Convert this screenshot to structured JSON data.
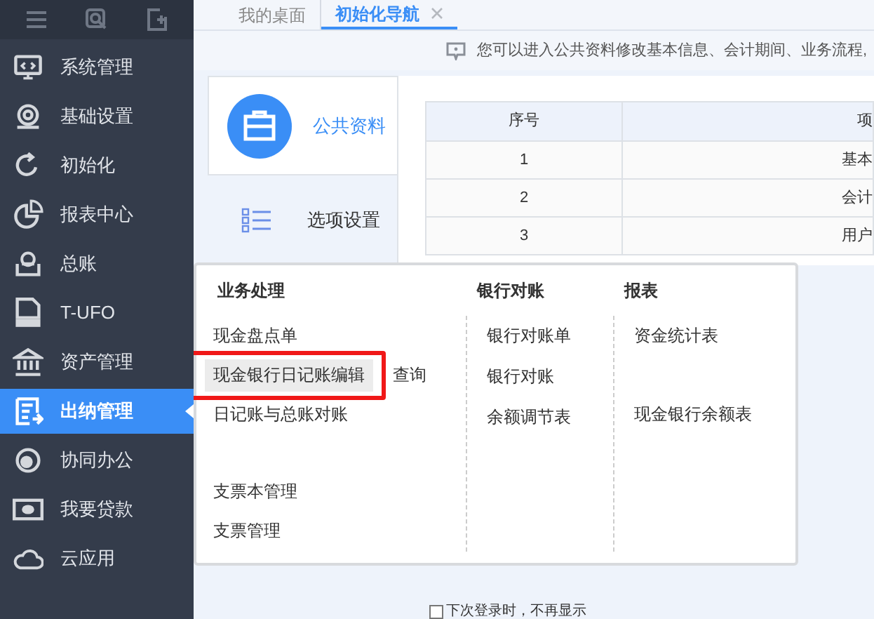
{
  "sidebar": {
    "items": [
      {
        "label": "系统管理",
        "selected": false
      },
      {
        "label": "基础设置",
        "selected": false
      },
      {
        "label": "初始化",
        "selected": false
      },
      {
        "label": "报表中心",
        "selected": false
      },
      {
        "label": "总账",
        "selected": false
      },
      {
        "label": "T-UFO",
        "selected": false
      },
      {
        "label": "资产管理",
        "selected": false
      },
      {
        "label": "出纳管理",
        "selected": true
      },
      {
        "label": "协同办公",
        "selected": false
      },
      {
        "label": "我要贷款",
        "selected": false
      },
      {
        "label": "云应用",
        "selected": false
      }
    ]
  },
  "tabs": [
    {
      "label": "我的桌面",
      "selected": false,
      "closable": false
    },
    {
      "label": "初始化导航",
      "selected": true,
      "closable": true
    }
  ],
  "notice": "您可以进入公共资料修改基本信息、会计期间、业务流程,",
  "nav": [
    {
      "label": "公共资料",
      "selected": true
    },
    {
      "label": "选项设置",
      "selected": false
    }
  ],
  "table": {
    "columns": [
      "序号",
      "项"
    ],
    "rows": [
      [
        "1",
        "基本"
      ],
      [
        "2",
        "会计"
      ],
      [
        "3",
        "用户"
      ]
    ]
  },
  "menu": {
    "columns": [
      {
        "title": "业务处理",
        "groups": [
          [
            {
              "label": "现金盘点单",
              "selected": false,
              "marked": false
            },
            {
              "label": "现金银行日记账编辑",
              "selected": true,
              "marked": true,
              "extra": "查询"
            },
            {
              "label": "日记账与总账对账",
              "selected": false,
              "marked": false
            }
          ],
          [
            {
              "label": "支票本管理",
              "selected": false,
              "marked": false
            },
            {
              "label": "支票管理",
              "selected": false,
              "marked": false
            }
          ]
        ]
      },
      {
        "title": "银行对账",
        "groups": [
          [
            {
              "label": "银行对账单",
              "selected": false,
              "marked": false
            },
            {
              "label": "银行对账",
              "selected": false,
              "marked": false
            },
            {
              "label": "余额调节表",
              "selected": false,
              "marked": false
            }
          ]
        ]
      },
      {
        "title": "报表",
        "groups": [
          [
            {
              "label": "资金统计表",
              "selected": false,
              "marked": false
            }
          ],
          [
            {
              "label": "现金银行余额表",
              "selected": false,
              "marked": false
            }
          ]
        ]
      }
    ]
  },
  "dont_show_again": {
    "label": "下次登录时，不再显示",
    "checked": false
  }
}
